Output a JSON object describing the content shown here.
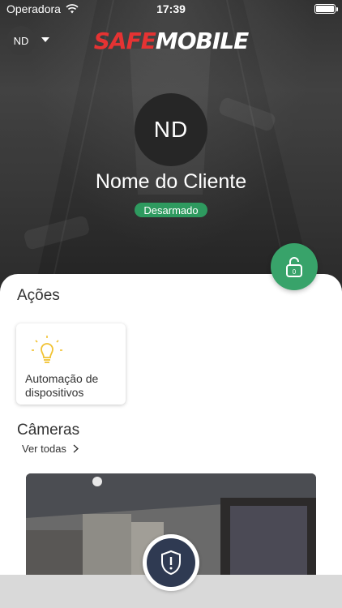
{
  "status_bar": {
    "carrier": "Operadora",
    "time": "17:39"
  },
  "header": {
    "user_initials": "ND",
    "logo_part1": "SAFE",
    "logo_part2": "MOBILE"
  },
  "profile": {
    "initials": "ND",
    "client_name": "Nome do Cliente",
    "status": "Desarmado"
  },
  "colors": {
    "accent_green": "#38a36a",
    "badge_green": "#2e9a5f",
    "logo_red": "#e53333",
    "shield_navy": "#2f3a52"
  },
  "actions": {
    "title": "Ações",
    "cards": [
      {
        "label": "Automação de dispositivos",
        "icon": "lightbulb-icon"
      }
    ]
  },
  "cameras": {
    "title": "Câmeras",
    "see_all": "Ver todas"
  },
  "icons": {
    "wifi": "wifi-icon",
    "battery": "battery-icon",
    "dropdown": "chevron-down-icon",
    "lock": "lock-open-icon",
    "shield": "shield-alert-icon",
    "see_all_arrow": "chevron-right-icon"
  }
}
